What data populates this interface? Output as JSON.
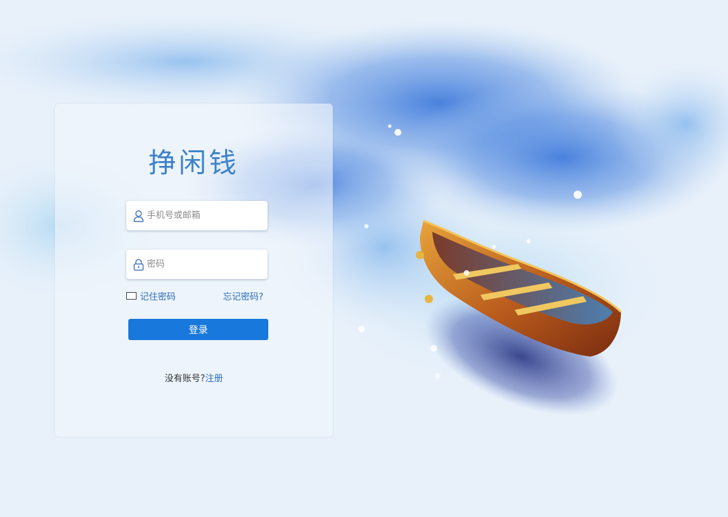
{
  "app": {
    "title": "挣闲钱"
  },
  "login_form": {
    "username_placeholder": "手机号或邮箱",
    "password_placeholder": "密码",
    "remember_label": "记住密码",
    "remember_checked": false,
    "forgot_label": "忘记密码?",
    "submit_label": "登录",
    "register_prompt": "没有账号?",
    "register_label": "注册"
  },
  "icons": {
    "username": "user-icon",
    "password": "lock-icon"
  },
  "colors": {
    "accent": "#1878dc",
    "link": "#2a6fb8",
    "title": "#3e82c8",
    "background": "#e9f1fa"
  }
}
